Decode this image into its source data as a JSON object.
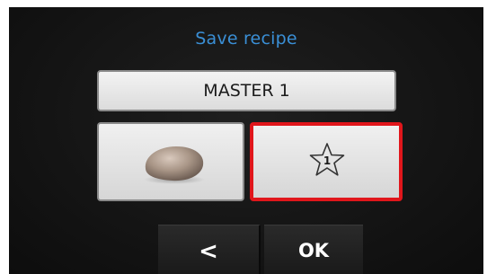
{
  "dialog": {
    "title": "Save recipe",
    "recipe_name": "MASTER 1",
    "image_tile": {
      "icon": "stone-icon"
    },
    "favorite_tile": {
      "icon": "star-icon",
      "number": "1",
      "selected": true,
      "highlight_color": "#e0161b"
    }
  },
  "footer": {
    "back_label": "<",
    "ok_label": "OK"
  },
  "colors": {
    "title": "#3a8fd6",
    "background": "#141414",
    "tile": "#e6e6e6",
    "selected_border": "#e0161b"
  }
}
